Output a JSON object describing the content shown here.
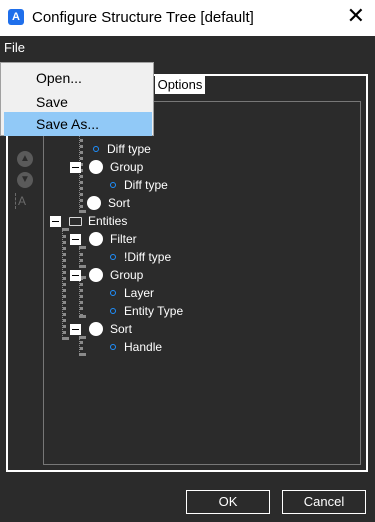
{
  "window": {
    "title": "Configure Structure Tree [default]"
  },
  "menu": {
    "file_label": "File",
    "file_items": [
      "Open...",
      "Save",
      "Save As..."
    ],
    "highlighted_index": 2
  },
  "tab": {
    "label": "Options"
  },
  "tree": {
    "nodes": [
      {
        "label": "Diff type",
        "icon": "dot-icon"
      },
      {
        "label": "Group",
        "icon": "radio-icon"
      },
      {
        "label": "Diff type",
        "icon": "dot-icon"
      },
      {
        "label": "Sort",
        "icon": "radio-icon"
      },
      {
        "label": "Entities",
        "icon": "folder-icon"
      },
      {
        "label": "Filter",
        "icon": "radio-icon"
      },
      {
        "label": "!Diff type",
        "icon": "dot-icon"
      },
      {
        "label": "Group",
        "icon": "radio-icon"
      },
      {
        "label": "Layer",
        "icon": "dot-icon"
      },
      {
        "label": "Entity Type",
        "icon": "dot-icon"
      },
      {
        "label": "Sort",
        "icon": "radio-icon"
      },
      {
        "label": "Handle",
        "icon": "dot-icon"
      }
    ]
  },
  "side_buttons": {
    "icons": [
      "arrow-up-icon",
      "arrow-down-icon",
      "text-edit-icon"
    ],
    "text_label": "A"
  },
  "buttons": {
    "ok_label": "OK",
    "cancel_label": "Cancel"
  },
  "colors": {
    "window_bg": "#2b2b2b",
    "menu_highlight": "#91c9f7",
    "dot_icon": "#1e90ff"
  }
}
